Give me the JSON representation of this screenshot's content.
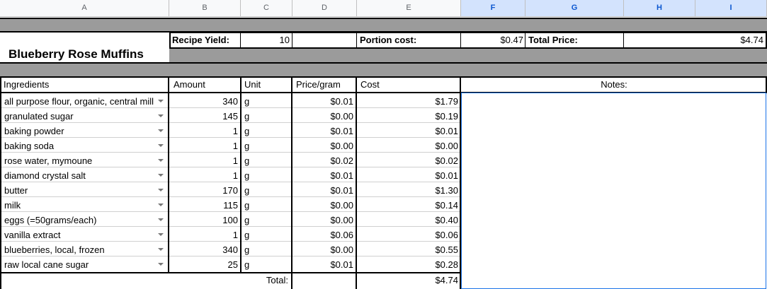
{
  "columns": [
    "A",
    "B",
    "C",
    "D",
    "E",
    "F",
    "G",
    "H",
    "I"
  ],
  "title": "Blueberry Rose Muffins",
  "yield": {
    "label": "Recipe Yield:",
    "value": "10"
  },
  "portion": {
    "label": "Portion cost:",
    "value": "$0.47"
  },
  "total_price": {
    "label": "Total Price:",
    "value": "$4.74"
  },
  "headers": {
    "ingredients": "Ingredients",
    "amount": "Amount",
    "unit": "Unit",
    "price": "Price/gram",
    "cost": "Cost",
    "notes": "Notes:"
  },
  "rows": [
    {
      "name": "all purpose flour, organic, central mill",
      "amount": "340",
      "unit": "g",
      "price": "$0.01",
      "cost": "$1.79"
    },
    {
      "name": "granulated sugar",
      "amount": "145",
      "unit": "g",
      "price": "$0.00",
      "cost": "$0.19"
    },
    {
      "name": "baking powder",
      "amount": "1",
      "unit": "g",
      "price": "$0.01",
      "cost": "$0.01"
    },
    {
      "name": "baking soda",
      "amount": "1",
      "unit": "g",
      "price": "$0.00",
      "cost": "$0.00"
    },
    {
      "name": "rose water, mymoune",
      "amount": "1",
      "unit": "g",
      "price": "$0.02",
      "cost": "$0.02"
    },
    {
      "name": "diamond crystal salt",
      "amount": "1",
      "unit": "g",
      "price": "$0.01",
      "cost": "$0.01"
    },
    {
      "name": "butter",
      "amount": "170",
      "unit": "g",
      "price": "$0.01",
      "cost": "$1.30"
    },
    {
      "name": "milk",
      "amount": "115",
      "unit": "g",
      "price": "$0.00",
      "cost": "$0.14"
    },
    {
      "name": "eggs (=50grams/each)",
      "amount": "100",
      "unit": "g",
      "price": "$0.00",
      "cost": "$0.40"
    },
    {
      "name": "vanilla extract",
      "amount": "1",
      "unit": "g",
      "price": "$0.06",
      "cost": "$0.06"
    },
    {
      "name": "blueberries, local, frozen",
      "amount": "340",
      "unit": "g",
      "price": "$0.00",
      "cost": "$0.55"
    },
    {
      "name": "raw local cane sugar",
      "amount": "25",
      "unit": "g",
      "price": "$0.01",
      "cost": "$0.28"
    }
  ],
  "total": {
    "label": "Total:",
    "value": "$4.74"
  }
}
